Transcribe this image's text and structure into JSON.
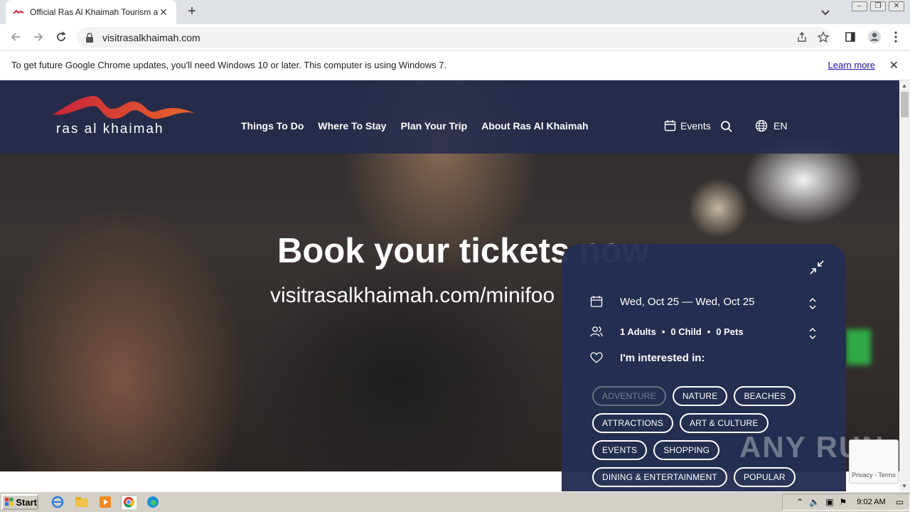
{
  "browser": {
    "tab_title": "Official Ras Al Khaimah Tourism and V",
    "url": "visitrasalkhaimah.com"
  },
  "infobar": {
    "message": "To get future Google Chrome updates, you'll need Windows 10 or later. This computer is using Windows 7.",
    "learn_more": "Learn more"
  },
  "site": {
    "logo_text": "ras al khaimah",
    "nav": [
      "Things To Do",
      "Where To Stay",
      "Plan Your Trip",
      "About Ras Al Khaimah"
    ],
    "events_label": "Events",
    "language": "EN"
  },
  "hero": {
    "title": "Book your tickets now",
    "url_text": "visitrasalkhaimah.com/minifoo"
  },
  "booking": {
    "dates": "Wed, Oct 25 — Wed, Oct 25",
    "adults": "1 Adults",
    "children": "0 Child",
    "pets": "0 Pets",
    "dot": "•",
    "interest_label": "I'm interested in:",
    "chips": [
      "ADVENTURE",
      "NATURE",
      "BEACHES",
      "ATTRACTIONS",
      "ART & CULTURE",
      "EVENTS",
      "SHOPPING",
      "DINING & ENTERTAINMENT",
      "POPULAR"
    ]
  },
  "recaptcha": {
    "text": "Privacy - Terms"
  },
  "watermark": "ANY RUN",
  "taskbar": {
    "start": "Start",
    "clock": "9:02 AM"
  },
  "colors": {
    "header_bg": "#242b4d",
    "panel_bg": "#242e52",
    "logo_red": "#c8243a",
    "logo_orange": "#e8652a"
  }
}
